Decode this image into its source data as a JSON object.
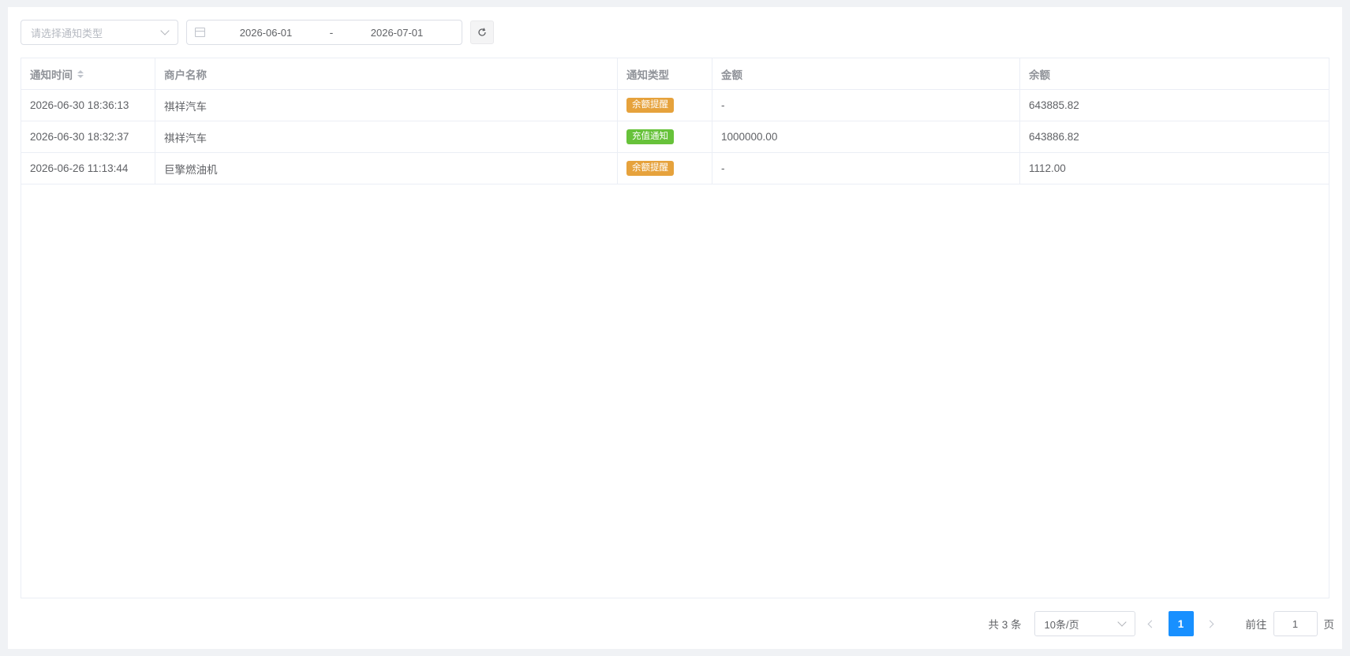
{
  "toolbar": {
    "type_select_placeholder": "请选择通知类型",
    "date_start": "2026-06-01",
    "date_sep": "-",
    "date_end": "2026-07-01"
  },
  "table": {
    "columns": [
      "通知时间",
      "商户名称",
      "通知类型",
      "金额",
      "余额"
    ],
    "rows": [
      {
        "time": "2026-06-30 18:36:13",
        "merchant": "祺祥汽车",
        "type": "余额提醒",
        "type_color": "#e6a23c",
        "amount": "-",
        "balance": "643885.82"
      },
      {
        "time": "2026-06-30 18:32:37",
        "merchant": "祺祥汽车",
        "type": "充值通知",
        "type_color": "#67c23a",
        "amount": "1000000.00",
        "balance": "643886.82"
      },
      {
        "time": "2026-06-26 11:13:44",
        "merchant": "巨擎燃油机",
        "type": "余额提醒",
        "type_color": "#e6a23c",
        "amount": "-",
        "balance": "1112.00"
      }
    ]
  },
  "pagination": {
    "total": "共 3 条",
    "page_size": "10条/页",
    "current_page": "1",
    "goto_label": "前往",
    "goto_value": "1",
    "page_unit": "页"
  },
  "colors": {
    "primary": "#1890ff",
    "warning": "#e6a23c",
    "success": "#67c23a"
  }
}
